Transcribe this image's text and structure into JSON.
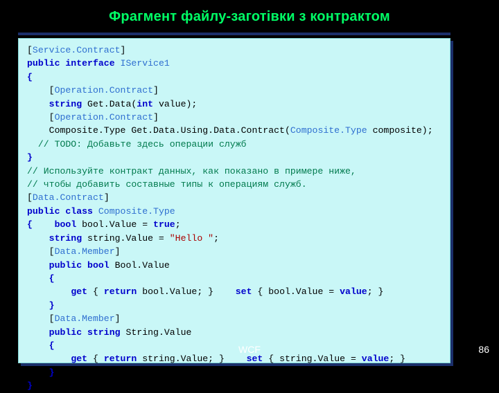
{
  "slide": {
    "title": "Фрагмент файлу-заготівки з контрактом",
    "footer_label": "WCF",
    "page_number": "86",
    "colors": {
      "background": "#000000",
      "title": "#00ff66",
      "panel_bg": "#c9f7f7",
      "panel_shadow": "#1b2f6b",
      "attribute": "#2f6fd0",
      "keyword": "#0000cc",
      "string": "#aa0000",
      "comment": "#007a4d",
      "footer_text": "#ffffff"
    }
  },
  "code": {
    "lines": [
      [
        {
          "t": "[",
          "c": "plain"
        },
        {
          "t": "Service.Contract",
          "c": "attr"
        },
        {
          "t": "]",
          "c": "plain"
        }
      ],
      [
        {
          "t": "public interface ",
          "c": "kw"
        },
        {
          "t": "IService1",
          "c": "attr"
        }
      ],
      [
        {
          "t": "{",
          "c": "kw"
        }
      ],
      [
        {
          "t": "    [",
          "c": "plain"
        },
        {
          "t": "Operation.Contract",
          "c": "attr"
        },
        {
          "t": "]",
          "c": "plain"
        }
      ],
      [
        {
          "t": "    ",
          "c": "plain"
        },
        {
          "t": "string",
          "c": "kw"
        },
        {
          "t": " Get.Data(",
          "c": "plain"
        },
        {
          "t": "int",
          "c": "kw"
        },
        {
          "t": " value);",
          "c": "plain"
        }
      ],
      [
        {
          "t": "    [",
          "c": "plain"
        },
        {
          "t": "Operation.Contract",
          "c": "attr"
        },
        {
          "t": "]",
          "c": "plain"
        }
      ],
      [
        {
          "t": "    Composite.Type Get.Data.Using.Data.Contract(",
          "c": "plain"
        },
        {
          "t": "Composite.Type",
          "c": "attr"
        },
        {
          "t": " composite);",
          "c": "plain"
        }
      ],
      [
        {
          "t": "  // TODO: Добавьте здесь операции служб",
          "c": "cmt"
        }
      ],
      [
        {
          "t": "}",
          "c": "kw"
        }
      ],
      [
        {
          "t": "// Используйте контракт данных, как показано в примере ниже,",
          "c": "cmt"
        }
      ],
      [
        {
          "t": "// чтобы добавить составные типы к операциям служб.",
          "c": "cmt"
        }
      ],
      [
        {
          "t": "[",
          "c": "plain"
        },
        {
          "t": "Data.Contract",
          "c": "attr"
        },
        {
          "t": "]",
          "c": "plain"
        }
      ],
      [
        {
          "t": "public class ",
          "c": "kw"
        },
        {
          "t": "Composite.Type",
          "c": "attr"
        }
      ],
      [
        {
          "t": "{",
          "c": "kw"
        },
        {
          "t": "    ",
          "c": "plain"
        },
        {
          "t": "bool",
          "c": "kw"
        },
        {
          "t": " bool.Value = ",
          "c": "plain"
        },
        {
          "t": "true",
          "c": "kw"
        },
        {
          "t": ";",
          "c": "plain"
        }
      ],
      [
        {
          "t": "    ",
          "c": "plain"
        },
        {
          "t": "string",
          "c": "kw"
        },
        {
          "t": " string.Value = ",
          "c": "plain"
        },
        {
          "t": "\"Hello \"",
          "c": "str"
        },
        {
          "t": ";",
          "c": "plain"
        }
      ],
      [
        {
          "t": "    [",
          "c": "plain"
        },
        {
          "t": "Data.Member",
          "c": "attr"
        },
        {
          "t": "]",
          "c": "plain"
        }
      ],
      [
        {
          "t": "    ",
          "c": "plain"
        },
        {
          "t": "public bool",
          "c": "kw"
        },
        {
          "t": " Bool.Value",
          "c": "plain"
        }
      ],
      [
        {
          "t": "    ",
          "c": "plain"
        },
        {
          "t": "{",
          "c": "kw"
        }
      ],
      [
        {
          "t": "        ",
          "c": "plain"
        },
        {
          "t": "get",
          "c": "kw"
        },
        {
          "t": " { ",
          "c": "plain"
        },
        {
          "t": "return",
          "c": "kw"
        },
        {
          "t": " bool.Value; }    ",
          "c": "plain"
        },
        {
          "t": "set",
          "c": "kw"
        },
        {
          "t": " { bool.Value = ",
          "c": "plain"
        },
        {
          "t": "value",
          "c": "kw"
        },
        {
          "t": "; }",
          "c": "plain"
        }
      ],
      [
        {
          "t": "    ",
          "c": "plain"
        },
        {
          "t": "}",
          "c": "kw"
        }
      ],
      [
        {
          "t": "    [",
          "c": "plain"
        },
        {
          "t": "Data.Member",
          "c": "attr"
        },
        {
          "t": "]",
          "c": "plain"
        }
      ],
      [
        {
          "t": "    ",
          "c": "plain"
        },
        {
          "t": "public string",
          "c": "kw"
        },
        {
          "t": " String.Value",
          "c": "plain"
        }
      ],
      [
        {
          "t": "    ",
          "c": "plain"
        },
        {
          "t": "{",
          "c": "kw"
        }
      ],
      [
        {
          "t": "        ",
          "c": "plain"
        },
        {
          "t": "get",
          "c": "kw"
        },
        {
          "t": " { ",
          "c": "plain"
        },
        {
          "t": "return",
          "c": "kw"
        },
        {
          "t": " string.Value; }    ",
          "c": "plain"
        },
        {
          "t": "set",
          "c": "kw"
        },
        {
          "t": " { string.Value = ",
          "c": "plain"
        },
        {
          "t": "value",
          "c": "kw"
        },
        {
          "t": "; }",
          "c": "plain"
        }
      ],
      [
        {
          "t": "    ",
          "c": "plain"
        },
        {
          "t": "}",
          "c": "kw"
        }
      ],
      [
        {
          "t": "}",
          "c": "kw"
        }
      ]
    ]
  }
}
